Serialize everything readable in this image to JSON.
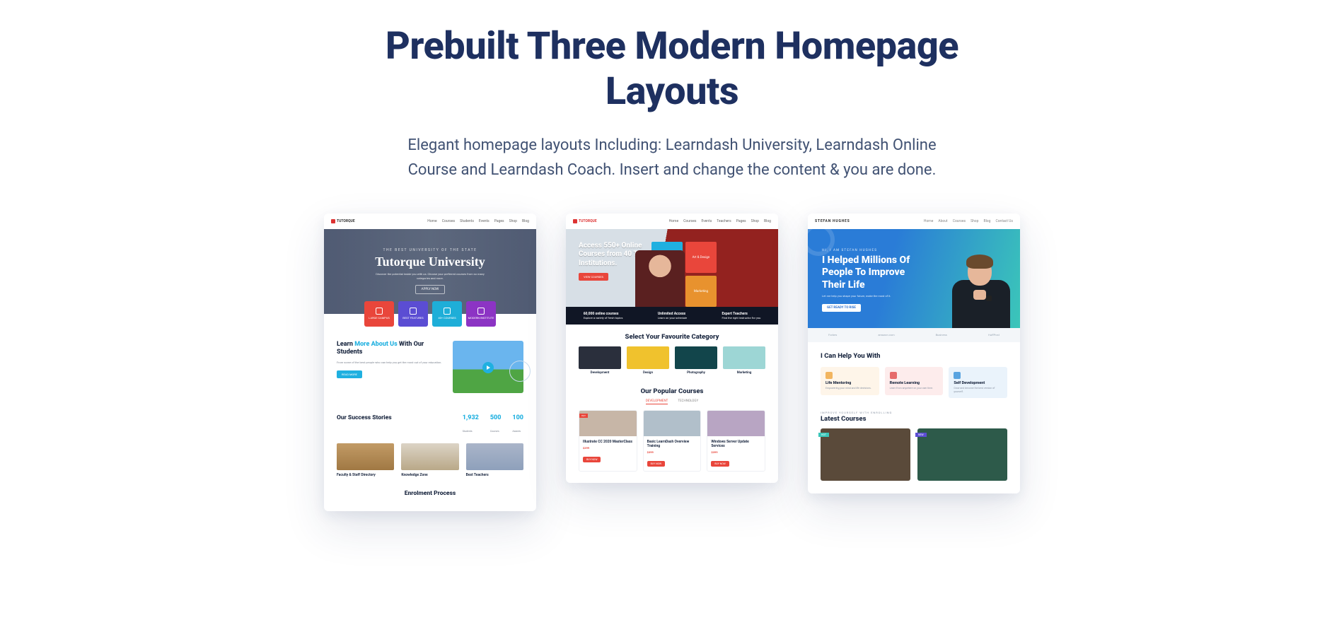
{
  "heading": "Prebuilt Three Modern Homepage Layouts",
  "subheading": "Elegant homepage layouts Including: Learndash University, Learndash Online Course and Learndash Coach. Insert and change the content & you are done.",
  "card1": {
    "logo": "TUTORQUE",
    "nav": [
      "Home",
      "Courses",
      "Students",
      "Events",
      "Pages",
      "Shop",
      "Blog"
    ],
    "hero_kicker": "THE BEST UNIVERSITY OF THE STATE",
    "hero_title": "Tutorque University",
    "hero_desc": "Discover the potential inside you with us. Choose your preferred courses from so many categories and more.",
    "hero_btn": "APPLY NOW",
    "chips": [
      {
        "label": "LARGE CAMPUS"
      },
      {
        "label": "BEST FEATURES"
      },
      {
        "label": "40+ COURSES"
      },
      {
        "label": "MODERN INSTITUTE"
      }
    ],
    "learn_kicker": "",
    "learn_title_a": "Learn ",
    "learn_title_b": "More About Us",
    "learn_title_c": " With Our Students",
    "learn_desc": "From some of the best people who can help you get the most out of your education.",
    "learn_btn": "READ MORE",
    "stats_title": "Our Success Stories",
    "stats": [
      {
        "n": "1,932",
        "l": "Students"
      },
      {
        "n": "500",
        "l": "Courses"
      },
      {
        "n": "100",
        "l": "Awards"
      }
    ],
    "thumbs": [
      {
        "t": "Faculty & Staff Directory"
      },
      {
        "t": "Knowledge Zone"
      },
      {
        "t": "Best Teachers"
      }
    ],
    "end": "Enrolment Process"
  },
  "card2": {
    "logo": "TUTORQUE",
    "nav": [
      "Home",
      "Courses",
      "Events",
      "Teachers",
      "Pages",
      "Shop",
      "Blog"
    ],
    "hero_title": "Access 550+ Online Courses from 40 Top Institutions.",
    "hero_btn": "VIEW COURSES",
    "grid": [
      "Development",
      "Art & Design",
      "Photography",
      "Marketing"
    ],
    "fbar": [
      {
        "b": "60,000 online courses",
        "s": "Explore a variety of fresh topics"
      },
      {
        "b": "Unlimited Access",
        "s": "Learn on your schedule"
      },
      {
        "b": "Expert Teachers",
        "s": "Find the right instructor for you"
      }
    ],
    "cat_title": "Select Your Favourite Category",
    "cats": [
      "Development",
      "Design",
      "Photography",
      "Marketing"
    ],
    "pop_title": "Our Popular Courses",
    "tabs": [
      "DEVELOPMENT",
      "TECHNOLOGY"
    ],
    "courses": [
      {
        "t": "Illustrate CC 2020 MasterClass",
        "p": "$399",
        "b": "BUY NOW",
        "bad": "HOT"
      },
      {
        "t": "Basic LearnDash Overview Training",
        "p": "$399",
        "b": "BUY NOW",
        "bad": ""
      },
      {
        "t": "Windows Server Update Services",
        "p": "$399",
        "b": "BUY NOW",
        "bad": ""
      }
    ]
  },
  "card3": {
    "logo": "STEFAN HUGHES",
    "nav": [
      "Home",
      "About",
      "Courses",
      "Shop",
      "Blog",
      "Contact Us"
    ],
    "hero_kicker": "HI, I AM STEFAN HUGHES",
    "hero_title": "I Helped Millions Of People To Improve Their Life",
    "hero_desc": "Let me help you shape your future, make the most of it.",
    "hero_btn": "GET READY TO RISE",
    "logos": [
      "Forbes",
      "amazon.com",
      "Business",
      "HuffPost"
    ],
    "help_title": "I Can Help You With",
    "help_items": [
      {
        "t": "Life Mentoring",
        "d": "Empowering your mind and life decisions."
      },
      {
        "t": "Remote Learning",
        "d": "Learn from anywhere on your own time."
      },
      {
        "t": "Self Development",
        "d": "Grow and become the best version of yourself."
      }
    ],
    "latest_kicker": "IMPROVE YOURSELF WITH ENROLLING",
    "latest_title": "Latest Courses",
    "latest_tags": [
      "HOT",
      "NEW"
    ]
  }
}
